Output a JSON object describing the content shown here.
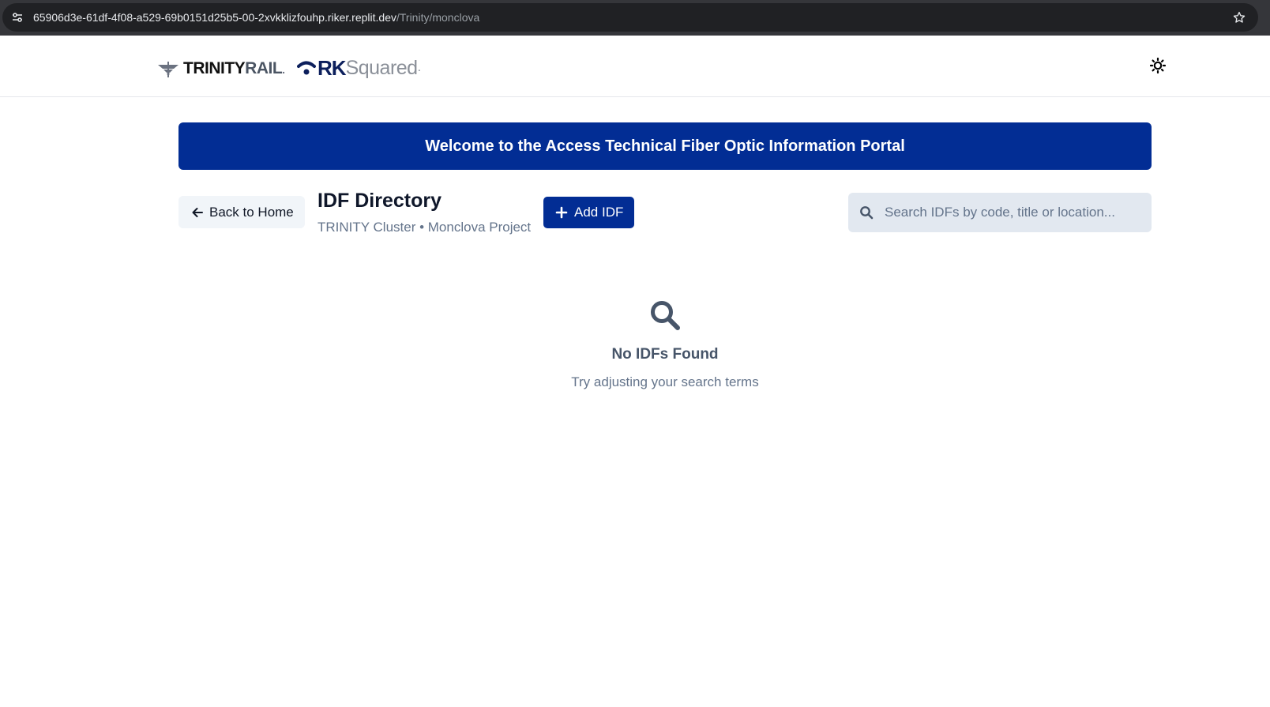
{
  "browser": {
    "url_host": "65906d3e-61df-4f08-a529-69b0151d25b5-00-2xvkklizfouhp.riker.replit.dev",
    "url_path": "/Trinity/monclova"
  },
  "header": {
    "logo_trinity_main": "TRINITY",
    "logo_trinity_rail": "RAIL",
    "logo_trinity_dot": ".",
    "logo_rk_main": "RK",
    "logo_rk_squared": "Squared",
    "logo_rk_dot": ".",
    "theme_icon": "sun-icon"
  },
  "banner": {
    "text": "Welcome to the Access Technical Fiber Optic Information Portal"
  },
  "toolbar": {
    "back_label": "Back to Home",
    "title": "IDF Directory",
    "subtitle": "TRINITY Cluster • Monclova Project",
    "add_label": "Add IDF",
    "search_placeholder": "Search IDFs by code, title or location..."
  },
  "empty_state": {
    "title": "No IDFs Found",
    "message": "Try adjusting your search terms"
  },
  "colors": {
    "brand_blue": "#022d94",
    "muted_text": "#64748b",
    "button_gray": "#f1f5f9"
  }
}
